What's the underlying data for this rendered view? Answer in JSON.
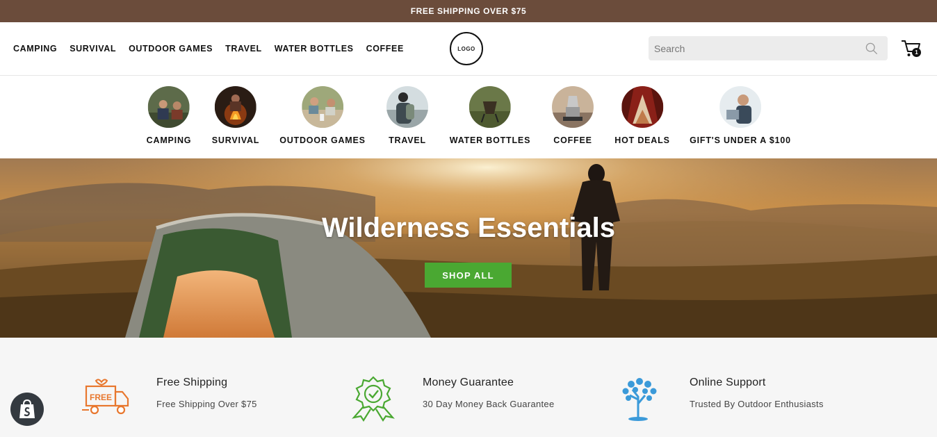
{
  "announcement": "FREE SHIPPING OVER $75",
  "nav": [
    "CAMPING",
    "SURVIVAL",
    "OUTDOOR GAMES",
    "TRAVEL",
    "WATER BOTTLES",
    "COFFEE"
  ],
  "logo_text": "LOGO",
  "search": {
    "placeholder": "Search"
  },
  "cart": {
    "count": "1"
  },
  "categories": [
    {
      "label": "CAMPING",
      "icon": "camping-photo"
    },
    {
      "label": "SURVIVAL",
      "icon": "campfire-photo"
    },
    {
      "label": "OUTDOOR GAMES",
      "icon": "picnic-photo"
    },
    {
      "label": "TRAVEL",
      "icon": "hiker-photo"
    },
    {
      "label": "WATER BOTTLES",
      "icon": "camp-chair-photo"
    },
    {
      "label": "COFFEE",
      "icon": "coffee-pot-photo"
    },
    {
      "label": "HOT DEALS",
      "icon": "tent-view-photo"
    },
    {
      "label": "GIFT'S UNDER A $100",
      "icon": "laptop-person-photo"
    }
  ],
  "hero": {
    "title": "Wilderness Essentials",
    "button": "SHOP ALL"
  },
  "features": [
    {
      "title": "Free Shipping",
      "text": "Free Shipping Over $75",
      "icon": "free-truck-icon",
      "icon_text": "FREE",
      "color": "#e8772e"
    },
    {
      "title": "Money Guarantee",
      "text": "30 Day Money Back Guarantee",
      "icon": "badge-check-icon",
      "color": "#4aa832"
    },
    {
      "title": "Online Support",
      "text": "Trusted By Outdoor Enthusiasts",
      "icon": "tree-icon",
      "color": "#3b9ad9"
    }
  ],
  "colors": {
    "announcement_bg": "#6b4c3b",
    "button_green": "#4aa832"
  }
}
